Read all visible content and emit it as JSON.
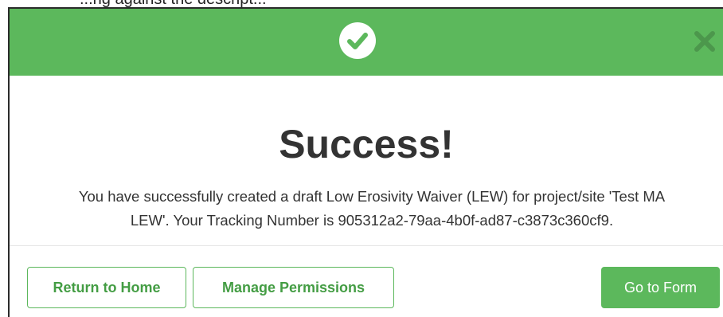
{
  "background_text": "...ng against the descript...",
  "header": {
    "icon": "check-circle-icon",
    "close_icon": "close-icon",
    "color": "#5cb85c"
  },
  "title": "Success!",
  "message_line1": "You have successfully created a draft Low Erosivity Waiver (LEW) for project/site 'Test MA",
  "message_line2": "LEW'. Your Tracking Number is 905312a2-79aa-4b0f-ad87-c3873c360cf9.",
  "buttons": {
    "return_home": "Return to Home",
    "manage_permissions": "Manage Permissions",
    "go_to_form": "Go to Form"
  }
}
